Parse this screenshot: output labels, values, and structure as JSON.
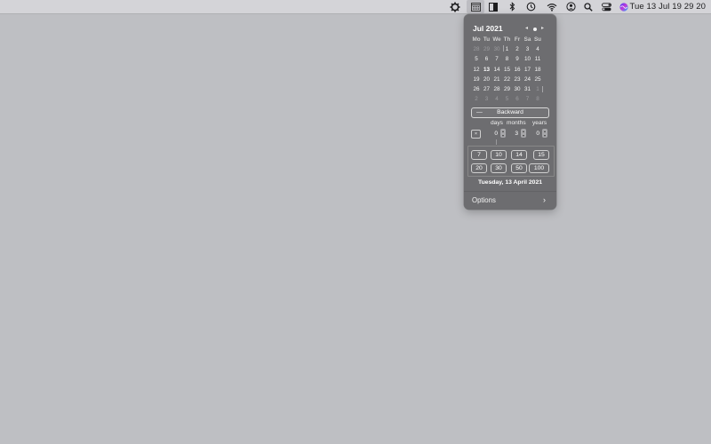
{
  "menubar": {
    "clock": "Tue 13 Jul  19 29 20",
    "icons": [
      "gear-icon",
      "calendar-icon",
      "split-square-icon",
      "bluetooth-icon",
      "time-machine-icon",
      "wifi-icon",
      "user-icon",
      "search-icon",
      "control-center-icon",
      "siri-icon"
    ]
  },
  "calendar": {
    "month_title": "Jul 2021",
    "nav_prev": "◂",
    "nav_next": "▸",
    "weekdays": [
      "Mo",
      "Tu",
      "We",
      "Th",
      "Fr",
      "Sa",
      "Su"
    ],
    "weeks": [
      [
        "28",
        "29",
        "30",
        "1",
        "2",
        "3",
        "4"
      ],
      [
        "5",
        "6",
        "7",
        "8",
        "9",
        "10",
        "11"
      ],
      [
        "12",
        "13",
        "14",
        "15",
        "16",
        "17",
        "18"
      ],
      [
        "19",
        "20",
        "21",
        "22",
        "23",
        "24",
        "25"
      ],
      [
        "26",
        "27",
        "28",
        "29",
        "30",
        "31",
        "1"
      ],
      [
        "2",
        "3",
        "4",
        "5",
        "6",
        "7",
        "8"
      ]
    ],
    "today": "13"
  },
  "calculator": {
    "direction_label": "Backward",
    "direction_dash": "—",
    "unit_labels": [
      "days",
      "months",
      "years"
    ],
    "clear_label": "×",
    "values": {
      "days": "0",
      "months": "3",
      "years": "0"
    },
    "presets_row1": [
      "7",
      "10",
      "14",
      "15"
    ],
    "presets_row2": [
      "20",
      "30",
      "50",
      "100"
    ],
    "result_date": "Tuesday, 13 April 2021"
  },
  "options": {
    "label": "Options",
    "chevron": "›"
  },
  "colors": {
    "today_highlight": "#1f6ee8",
    "popover_bg": "#6d6d70",
    "desktop_bg": "#bebfc3"
  }
}
